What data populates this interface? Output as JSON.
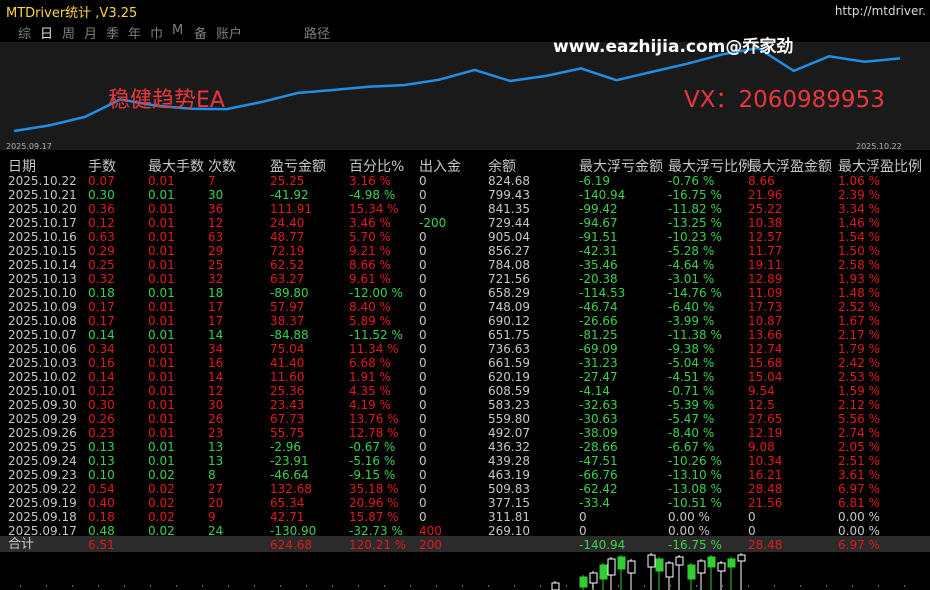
{
  "app": {
    "title": "MTDriver统计 ,V3.25",
    "url": "http://mtdriver."
  },
  "tabs": [
    "综",
    "日",
    "周",
    "月",
    "季",
    "年",
    "巾",
    "M",
    "备",
    "账户",
    "路径"
  ],
  "active_tab": 1,
  "chart": {
    "watermark": "www.eazhijia.com@乔家劲",
    "ea_name": "稳健趋势EA",
    "vx": "VX：2060989953",
    "start_date": "2025.09.17",
    "end_date": "2025.10.22",
    "line_color": "#1e8fe6",
    "balance_series": [
      269.1,
      311.81,
      377.15,
      509.83,
      463.19,
      439.28,
      436.32,
      492.07,
      559.8,
      583.23,
      608.59,
      620.19,
      661.59,
      736.63,
      651.75,
      690.12,
      748.09,
      658.29,
      721.56,
      784.08,
      856.27,
      905.04,
      729.44,
      841.35,
      799.43,
      824.68
    ]
  },
  "table": {
    "headers": [
      "日期",
      "手数",
      "最大手数",
      "次数",
      "盈亏金额",
      "百分比%",
      "出入金",
      "余额",
      "最大浮亏金额",
      "最大浮亏比例",
      "最大浮盈金额",
      "最大浮盈比例"
    ],
    "rows": [
      {
        "date": "2025.10.22",
        "lots": "0.07",
        "maxlot": "0.01",
        "count": "7",
        "pl": "25.25",
        "pct": "3.16 %",
        "io": "0",
        "bal": "824.68",
        "mdd": "-6.19",
        "mddp": "-0.76 %",
        "mfp": "8.66",
        "mfpp": "1.06 %"
      },
      {
        "date": "2025.10.21",
        "lots": "0.30",
        "maxlot": "0.01",
        "count": "30",
        "pl": "-41.92",
        "pct": "-4.98 %",
        "io": "0",
        "bal": "799.43",
        "mdd": "-140.94",
        "mddp": "-16.75 %",
        "mfp": "21.96",
        "mfpp": "2.39 %"
      },
      {
        "date": "2025.10.20",
        "lots": "0.36",
        "maxlot": "0.01",
        "count": "36",
        "pl": "111.91",
        "pct": "15.34 %",
        "io": "0",
        "bal": "841.35",
        "mdd": "-99.42",
        "mddp": "-11.82 %",
        "mfp": "25.22",
        "mfpp": "3.34 %"
      },
      {
        "date": "2025.10.17",
        "lots": "0.12",
        "maxlot": "0.01",
        "count": "12",
        "pl": "24.40",
        "pct": "3.46 %",
        "io": "-200",
        "bal": "729.44",
        "mdd": "-94.67",
        "mddp": "-13.25 %",
        "mfp": "10.38",
        "mfpp": "1.46 %"
      },
      {
        "date": "2025.10.16",
        "lots": "0.63",
        "maxlot": "0.01",
        "count": "63",
        "pl": "48.77",
        "pct": "5.70 %",
        "io": "0",
        "bal": "905.04",
        "mdd": "-91.51",
        "mddp": "-10.23 %",
        "mfp": "12.57",
        "mfpp": "1.54 %"
      },
      {
        "date": "2025.10.15",
        "lots": "0.29",
        "maxlot": "0.01",
        "count": "29",
        "pl": "72.19",
        "pct": "9.21 %",
        "io": "0",
        "bal": "856.27",
        "mdd": "-42.31",
        "mddp": "-5.28 %",
        "mfp": "11.77",
        "mfpp": "1.50 %"
      },
      {
        "date": "2025.10.14",
        "lots": "0.25",
        "maxlot": "0.01",
        "count": "25",
        "pl": "62.52",
        "pct": "8.66 %",
        "io": "0",
        "bal": "784.08",
        "mdd": "-35.46",
        "mddp": "-4.64 %",
        "mfp": "19.11",
        "mfpp": "2.58 %"
      },
      {
        "date": "2025.10.13",
        "lots": "0.32",
        "maxlot": "0.01",
        "count": "32",
        "pl": "63.27",
        "pct": "9.61 %",
        "io": "0",
        "bal": "721.56",
        "mdd": "-20.38",
        "mddp": "-3.01 %",
        "mfp": "12.89",
        "mfpp": "1.93 %"
      },
      {
        "date": "2025.10.10",
        "lots": "0.18",
        "maxlot": "0.01",
        "count": "18",
        "pl": "-89.80",
        "pct": "-12.00 %",
        "io": "0",
        "bal": "658.29",
        "mdd": "-114.53",
        "mddp": "-14.76 %",
        "mfp": "11.09",
        "mfpp": "1.48 %"
      },
      {
        "date": "2025.10.09",
        "lots": "0.17",
        "maxlot": "0.01",
        "count": "17",
        "pl": "57.97",
        "pct": "8.40 %",
        "io": "0",
        "bal": "748.09",
        "mdd": "-46.74",
        "mddp": "-6.40 %",
        "mfp": "17.73",
        "mfpp": "2.52 %"
      },
      {
        "date": "2025.10.08",
        "lots": "0.17",
        "maxlot": "0.01",
        "count": "17",
        "pl": "38.37",
        "pct": "5.89 %",
        "io": "0",
        "bal": "690.12",
        "mdd": "-26.66",
        "mddp": "-3.99 %",
        "mfp": "10.87",
        "mfpp": "1.67 %"
      },
      {
        "date": "2025.10.07",
        "lots": "0.14",
        "maxlot": "0.01",
        "count": "14",
        "pl": "-84.88",
        "pct": "-11.52 %",
        "io": "0",
        "bal": "651.75",
        "mdd": "-81.25",
        "mddp": "-11.38 %",
        "mfp": "13.66",
        "mfpp": "2.17 %"
      },
      {
        "date": "2025.10.06",
        "lots": "0.34",
        "maxlot": "0.01",
        "count": "34",
        "pl": "75.04",
        "pct": "11.34 %",
        "io": "0",
        "bal": "736.63",
        "mdd": "-69.09",
        "mddp": "-9.38 %",
        "mfp": "12.74",
        "mfpp": "1.79 %"
      },
      {
        "date": "2025.10.03",
        "lots": "0.16",
        "maxlot": "0.01",
        "count": "16",
        "pl": "41.40",
        "pct": "6.68 %",
        "io": "0",
        "bal": "661.59",
        "mdd": "-31.23",
        "mddp": "-5.04 %",
        "mfp": "15.68",
        "mfpp": "2.42 %"
      },
      {
        "date": "2025.10.02",
        "lots": "0.14",
        "maxlot": "0.01",
        "count": "14",
        "pl": "11.60",
        "pct": "1.91 %",
        "io": "0",
        "bal": "620.19",
        "mdd": "-27.47",
        "mddp": "-4.51 %",
        "mfp": "15.04",
        "mfpp": "2.53 %"
      },
      {
        "date": "2025.10.01",
        "lots": "0.12",
        "maxlot": "0.01",
        "count": "12",
        "pl": "25.36",
        "pct": "4.35 %",
        "io": "0",
        "bal": "608.59",
        "mdd": "-4.14",
        "mddp": "-0.71 %",
        "mfp": "9.54",
        "mfpp": "1.59 %"
      },
      {
        "date": "2025.09.30",
        "lots": "0.30",
        "maxlot": "0.01",
        "count": "30",
        "pl": "23.43",
        "pct": "4.19 %",
        "io": "0",
        "bal": "583.23",
        "mdd": "-32.63",
        "mddp": "-5.39 %",
        "mfp": "12.5",
        "mfpp": "2.12 %"
      },
      {
        "date": "2025.09.29",
        "lots": "0.26",
        "maxlot": "0.01",
        "count": "26",
        "pl": "67.73",
        "pct": "13.76 %",
        "io": "0",
        "bal": "559.80",
        "mdd": "-30.63",
        "mddp": "-5.47 %",
        "mfp": "27.65",
        "mfpp": "5.56 %"
      },
      {
        "date": "2025.09.26",
        "lots": "0.23",
        "maxlot": "0.01",
        "count": "23",
        "pl": "55.75",
        "pct": "12.78 %",
        "io": "0",
        "bal": "492.07",
        "mdd": "-38.09",
        "mddp": "-8.40 %",
        "mfp": "12.19",
        "mfpp": "2.74 %"
      },
      {
        "date": "2025.09.25",
        "lots": "0.13",
        "maxlot": "0.01",
        "count": "13",
        "pl": "-2.96",
        "pct": "-0.67 %",
        "io": "0",
        "bal": "436.32",
        "mdd": "-28.66",
        "mddp": "-6.67 %",
        "mfp": "9.08",
        "mfpp": "2.05 %"
      },
      {
        "date": "2025.09.24",
        "lots": "0.13",
        "maxlot": "0.01",
        "count": "13",
        "pl": "-23.91",
        "pct": "-5.16 %",
        "io": "0",
        "bal": "439.28",
        "mdd": "-47.51",
        "mddp": "-10.26 %",
        "mfp": "10.34",
        "mfpp": "2.51 %"
      },
      {
        "date": "2025.09.23",
        "lots": "0.10",
        "maxlot": "0.02",
        "count": "8",
        "pl": "-46.64",
        "pct": "-9.15 %",
        "io": "0",
        "bal": "463.19",
        "mdd": "-66.76",
        "mddp": "-13.10 %",
        "mfp": "16.21",
        "mfpp": "3.61 %"
      },
      {
        "date": "2025.09.22",
        "lots": "0.54",
        "maxlot": "0.02",
        "count": "27",
        "pl": "132.68",
        "pct": "35.18 %",
        "io": "0",
        "bal": "509.83",
        "mdd": "-62.42",
        "mddp": "-13.08 %",
        "mfp": "28.48",
        "mfpp": "6.97 %"
      },
      {
        "date": "2025.09.19",
        "lots": "0.40",
        "maxlot": "0.02",
        "count": "20",
        "pl": "65.34",
        "pct": "20.96 %",
        "io": "0",
        "bal": "377.15",
        "mdd": "-33.4",
        "mddp": "-10.51 %",
        "mfp": "21.56",
        "mfpp": "6.81 %"
      },
      {
        "date": "2025.09.18",
        "lots": "0.18",
        "maxlot": "0.02",
        "count": "9",
        "pl": "42.71",
        "pct": "15.87 %",
        "io": "0",
        "bal": "311.81",
        "mdd": "0",
        "mddp": "0.00 %",
        "mfp": "0",
        "mfpp": "0.00 %"
      },
      {
        "date": "2025.09.17",
        "lots": "0.48",
        "maxlot": "0.02",
        "count": "24",
        "pl": "-130.90",
        "pct": "-32.73 %",
        "io": "400",
        "bal": "269.10",
        "mdd": "0",
        "mddp": "0.00 %",
        "mfp": "0",
        "mfpp": "0.00 %"
      }
    ],
    "total": {
      "label": "合计",
      "lots": "6.51",
      "pl": "624.68",
      "pct": "120.21 %",
      "io": "200",
      "mdd": "-140.94",
      "mddp": "-16.75 %",
      "mfp": "28.48",
      "mfpp": "6.97 %"
    },
    "colors": {
      "red": "#e01b1b",
      "green": "#3ad24a",
      "white": "#c8c8c8"
    }
  }
}
